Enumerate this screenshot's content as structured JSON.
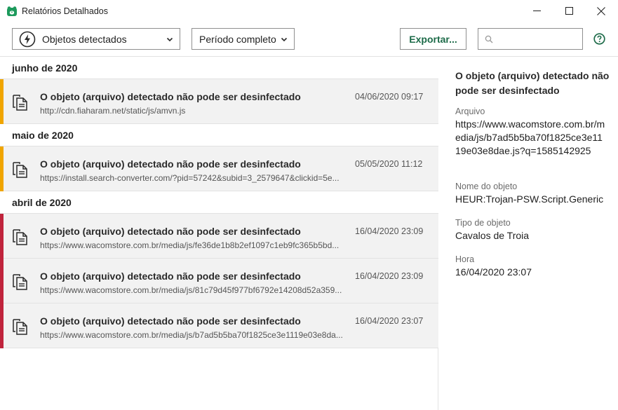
{
  "window": {
    "title": "Relatórios Detalhados"
  },
  "toolbar": {
    "type_filter": "Objetos detectados",
    "period_filter": "Período completo",
    "export_label": "Exportar...",
    "search_placeholder": ""
  },
  "colors": {
    "accent_green": "#1d6b49",
    "warning_orange": "#f0a500",
    "danger_red": "#c0243c"
  },
  "groups": [
    {
      "label": "junho de 2020",
      "items": [
        {
          "title": "O objeto (arquivo) detectado não pode ser desinfectado",
          "url": "http://cdn.fiaharam.net/static/js/amvn.js",
          "time": "04/06/2020 09:17",
          "severity": "warning"
        }
      ]
    },
    {
      "label": "maio de 2020",
      "items": [
        {
          "title": "O objeto (arquivo) detectado não pode ser desinfectado",
          "url": "https://install.search-converter.com/?pid=57242&subid=3_2579647&clickid=5e...",
          "time": "05/05/2020 11:12",
          "severity": "warning"
        }
      ]
    },
    {
      "label": "abril de 2020",
      "items": [
        {
          "title": "O objeto (arquivo) detectado não pode ser desinfectado",
          "url": "https://www.wacomstore.com.br/media/js/fe36de1b8b2ef1097c1eb9fc365b5bd...",
          "time": "16/04/2020 23:09",
          "severity": "danger"
        },
        {
          "title": "O objeto (arquivo) detectado não pode ser desinfectado",
          "url": "https://www.wacomstore.com.br/media/js/81c79d45f977bf6792e14208d52a359...",
          "time": "16/04/2020 23:09",
          "severity": "danger"
        },
        {
          "title": "O objeto (arquivo) detectado não pode ser desinfectado",
          "url": "https://www.wacomstore.com.br/media/js/b7ad5b5ba70f1825ce3e1119e03e8da...",
          "time": "16/04/2020 23:07",
          "severity": "danger"
        }
      ]
    }
  ],
  "details": {
    "title": "O objeto (arquivo) detectado não pode ser desinfectado",
    "file_label": "Arquivo",
    "file_value": "https://www.wacomstore.com.br/media/js/b7ad5b5ba70f1825ce3e1119e03e8dae.js?q=1585142925",
    "name_label": "Nome do objeto",
    "name_value": "HEUR:Trojan-PSW.Script.Generic",
    "type_label": "Tipo de objeto",
    "type_value": "Cavalos de Troia",
    "time_label": "Hora",
    "time_value": "16/04/2020 23:07"
  }
}
